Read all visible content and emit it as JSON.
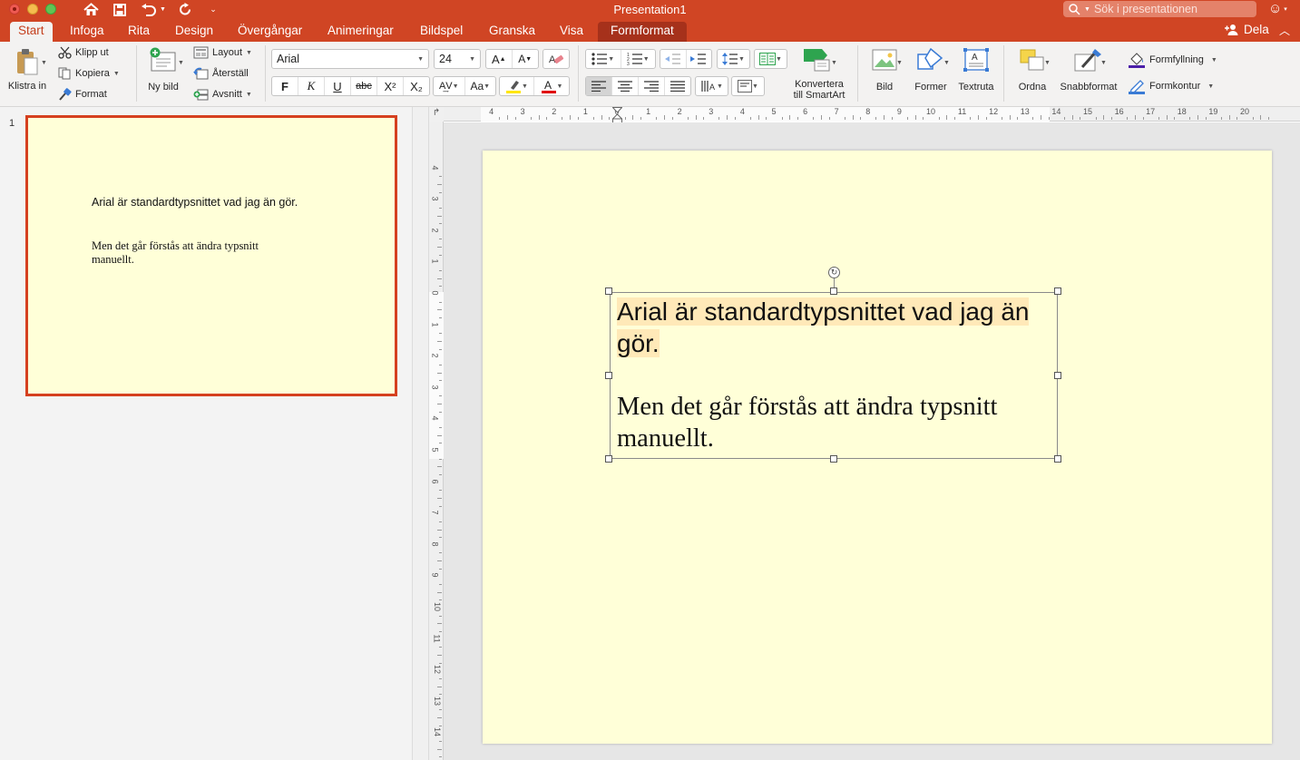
{
  "window": {
    "title": "Presentation1",
    "search_placeholder": "Sök i presentationen"
  },
  "tabs": [
    {
      "label": "Start",
      "active": true
    },
    {
      "label": "Infoga"
    },
    {
      "label": "Rita"
    },
    {
      "label": "Design"
    },
    {
      "label": "Övergångar"
    },
    {
      "label": "Animeringar"
    },
    {
      "label": "Bildspel"
    },
    {
      "label": "Granska"
    },
    {
      "label": "Visa"
    },
    {
      "label": "Formformat",
      "contextual": true
    }
  ],
  "share_label": "Dela",
  "ribbon": {
    "paste": "Klistra in",
    "cut": "Klipp ut",
    "copy": "Kopiera",
    "format_painter": "Format",
    "new_slide": "Ny bild",
    "layout": "Layout",
    "reset": "Återställ",
    "section": "Avsnitt",
    "font_name": "Arial",
    "font_size": "24",
    "bold": "F",
    "italic": "K",
    "underline": "U",
    "strike": "abc",
    "superscript": "X²",
    "subscript": "X₂",
    "convert_smartart_line1": "Konvertera",
    "convert_smartart_line2": "till SmartArt",
    "picture": "Bild",
    "shapes": "Former",
    "textbox": "Textruta",
    "arrange": "Ordna",
    "quick_styles": "Snabbformat",
    "shape_fill": "Formfyllning",
    "shape_outline": "Formkontur"
  },
  "colors": {
    "brand": "#d04524",
    "highlight": "#ffe600",
    "font_color": "#e00000",
    "slide_bg": "#ffffd8",
    "selection": "#d5401f"
  },
  "thumbnail": {
    "number": "1",
    "line1": "Arial är standardtypsnittet vad jag än gör.",
    "line2": "Men det går förstås att ändra typsnitt manuellt."
  },
  "slide": {
    "line1": "Arial är standardtypsnittet vad jag än gör.",
    "line2": "Men det går förstås att ändra typsnitt manuellt."
  },
  "ruler": {
    "horizontal": [
      "4",
      "3",
      "2",
      "1",
      "0",
      "1",
      "2",
      "3",
      "4",
      "5",
      "6",
      "7",
      "8",
      "9",
      "10",
      "11",
      "12",
      "13",
      "14",
      "15",
      "16",
      "17",
      "18",
      "19",
      "20"
    ],
    "vertical": [
      "4",
      "3",
      "2",
      "1",
      "0",
      "1",
      "2",
      "3",
      "4",
      "5",
      "6",
      "7",
      "8",
      "9",
      "10",
      "11",
      "12",
      "13",
      "14"
    ]
  }
}
